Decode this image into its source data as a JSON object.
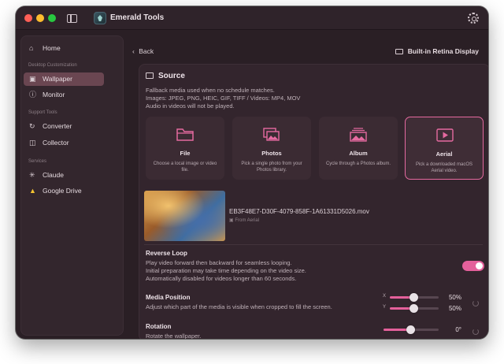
{
  "app": {
    "title": "Emerald Tools"
  },
  "sidebar": {
    "items": [
      {
        "label": "Home",
        "icon": "home-icon"
      },
      {
        "label": "Wallpaper",
        "icon": "image-icon",
        "active": true
      },
      {
        "label": "Monitor",
        "icon": "info-icon"
      },
      {
        "label": "Converter",
        "icon": "refresh-icon"
      },
      {
        "label": "Collector",
        "icon": "collector-icon"
      },
      {
        "label": "Claude",
        "icon": "claude-icon"
      },
      {
        "label": "Google Drive",
        "icon": "google-drive-icon"
      }
    ],
    "sections": [
      "Desktop Customization",
      "Support Tools",
      "Services"
    ]
  },
  "header": {
    "back_label": "Back",
    "display_label": "Built-in Retina Display"
  },
  "source": {
    "title": "Source",
    "desc_lines": [
      "Fallback media used when no schedule matches.",
      "Images: JPEG, PNG, HEIC, GIF, TIFF / Videos: MP4, MOV",
      "Audio in videos will not be played."
    ],
    "cards": [
      {
        "title": "File",
        "sub": "Choose a local image or video file.",
        "icon": "folder-icon"
      },
      {
        "title": "Photos",
        "sub": "Pick a single photo from your Photos library.",
        "icon": "photos-icon"
      },
      {
        "title": "Album",
        "sub": "Cycle through a Photos album.",
        "icon": "album-icon"
      },
      {
        "title": "Aerial",
        "sub": "Pick a downloaded macOS Aerial video.",
        "icon": "play-icon",
        "selected": true
      }
    ],
    "file_name": "EB3F48E7-D30F-4079-858F-1A61331D5026.mov",
    "from_label": "From Aerial"
  },
  "settings": {
    "reverse_loop": {
      "title": "Reverse Loop",
      "desc_lines": [
        "Play video forward then backward for seamless looping.",
        "Initial preparation may take time depending on the video size.",
        "Automatically disabled for videos longer than 60 seconds."
      ],
      "enabled": true
    },
    "media_position": {
      "title": "Media Position",
      "desc": "Adjust which part of the media is visible when cropped to fill the screen.",
      "x_label": "X",
      "y_label": "Y",
      "x_value": "50%",
      "y_value": "50%",
      "x_level": 0.5,
      "y_level": 0.5
    },
    "rotation": {
      "title": "Rotation",
      "desc": "Rotate the wallpaper.",
      "value": "0°",
      "level": 0.5
    }
  },
  "colors": {
    "accent": "#e4609b",
    "background": "#2a1f25",
    "sidebar": "#33262d"
  }
}
